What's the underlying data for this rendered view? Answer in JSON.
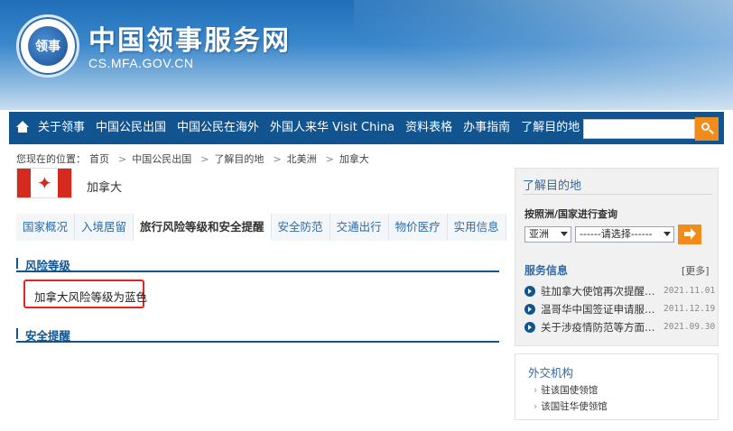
{
  "header": {
    "emblem_text": "领事",
    "site_title": "中国领事服务网",
    "site_domain": "CS.MFA.GOV.CN"
  },
  "nav": {
    "items": [
      "关于领事",
      "中国公民出国",
      "中国公民在海外",
      "外国人来华 Visit China",
      "资料表格",
      "办事指南",
      "了解目的地"
    ],
    "search_placeholder": ""
  },
  "breadcrumb": {
    "prefix": "您现在的位置：",
    "items": [
      "首页",
      "中国公民出国",
      "了解目的地",
      "北美洲",
      "加拿大"
    ]
  },
  "country": {
    "name": "加拿大"
  },
  "tabs": [
    "国家概况",
    "入境居留",
    "旅行风险等级和安全提醒",
    "安全防范",
    "交通出行",
    "物价医疗",
    "实用信息"
  ],
  "sections": {
    "risk_title": "风险等级",
    "risk_text": "加拿大风险等级为蓝色",
    "alert_title": "安全提醒"
  },
  "right_panel": {
    "title": "了解目的地",
    "query_label": "按照洲/国家进行查询",
    "continent_select": "亚洲",
    "country_select": "------请选择------",
    "news_title": "服务信息",
    "more_label": "[更多]",
    "news": [
      {
        "headline": "驻加拿大使馆再次提醒…",
        "date": "2021.11.01"
      },
      {
        "headline": "温哥华中国签证申请服…",
        "date": "2011.12.19"
      },
      {
        "headline": "关于涉疫情防范等方面…",
        "date": "2021.09.30"
      }
    ]
  },
  "org_panel": {
    "title": "外交机构",
    "links": [
      "驻该国使领馆",
      "该国驻华使领馆"
    ]
  },
  "colors": {
    "nav_bg": "#12548f",
    "accent_orange": "#f08c1c",
    "flag_red": "#d52b1e",
    "highlight_red": "#e2261f",
    "link_blue": "#2d6aa6"
  }
}
